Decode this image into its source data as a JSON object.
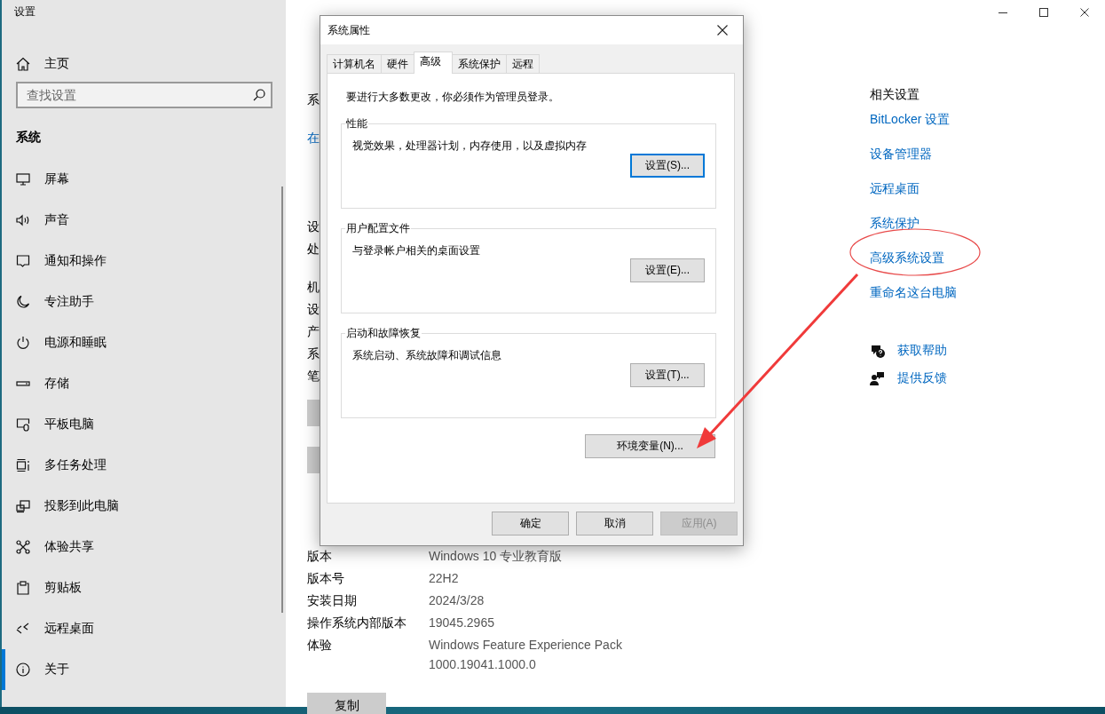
{
  "window": {
    "title": "设置"
  },
  "sidebar": {
    "home": "主页",
    "search": {
      "placeholder": "查找设置"
    },
    "section": "系统",
    "items": [
      {
        "label": "屏幕",
        "selected": false
      },
      {
        "label": "声音",
        "selected": false
      },
      {
        "label": "通知和操作",
        "selected": false
      },
      {
        "label": "专注助手",
        "selected": false
      },
      {
        "label": "电源和睡眠",
        "selected": false
      },
      {
        "label": "存储",
        "selected": false
      },
      {
        "label": "平板电脑",
        "selected": false
      },
      {
        "label": "多任务处理",
        "selected": false
      },
      {
        "label": "投影到此电脑",
        "selected": false
      },
      {
        "label": "体验共享",
        "selected": false
      },
      {
        "label": "剪贴板",
        "selected": false
      },
      {
        "label": "远程桌面",
        "selected": false
      },
      {
        "label": "关于",
        "selected": true
      }
    ]
  },
  "main": {
    "fragments": [
      {
        "kind": "text",
        "text": "系"
      },
      {
        "kind": "link",
        "text": "在"
      },
      {
        "kind": "text",
        "text": "设"
      },
      {
        "kind": "text",
        "text": "处"
      },
      {
        "kind": "text",
        "text": "机"
      },
      {
        "kind": "text",
        "text": "设"
      },
      {
        "kind": "text",
        "text": "产"
      },
      {
        "kind": "text",
        "text": "系"
      },
      {
        "kind": "text",
        "text": "笔"
      },
      {
        "kind": "button"
      },
      {
        "kind": "button"
      }
    ],
    "specs": [
      {
        "label": "版本",
        "value": "Windows 10 专业教育版"
      },
      {
        "label": "版本号",
        "value": "22H2"
      },
      {
        "label": "安装日期",
        "value": "2024/3/28"
      },
      {
        "label": "操作系统内部版本",
        "value": "19045.2965"
      },
      {
        "label": "体验",
        "value": "Windows Feature Experience Pack 1000.19041.1000.0"
      }
    ],
    "copy_button": "复制"
  },
  "related": {
    "heading": "相关设置",
    "links": [
      "BitLocker 设置",
      "设备管理器",
      "远程桌面",
      "系统保护",
      "高级系统设置",
      "重命名这台电脑"
    ],
    "help": [
      {
        "label": "获取帮助"
      },
      {
        "label": "提供反馈"
      }
    ]
  },
  "dialog": {
    "title": "系统属性",
    "tabs": [
      {
        "label": "计算机名",
        "selected": false
      },
      {
        "label": "硬件",
        "selected": false
      },
      {
        "label": "高级",
        "selected": true
      },
      {
        "label": "系统保护",
        "selected": false
      },
      {
        "label": "远程",
        "selected": false
      }
    ],
    "notice": "要进行大多数更改，你必须作为管理员登录。",
    "groups": [
      {
        "title": "性能",
        "description": "视觉效果，处理器计划，内存使用，以及虚拟内存",
        "button": "设置(S)...",
        "focused": true
      },
      {
        "title": "用户配置文件",
        "description": "与登录帐户相关的桌面设置",
        "button": "设置(E)...",
        "focused": false
      },
      {
        "title": "启动和故障恢复",
        "description": "系统启动、系统故障和调试信息",
        "button": "设置(T)...",
        "focused": false
      }
    ],
    "env_button": "环境变量(N)...",
    "buttons": [
      {
        "label": "确定",
        "disabled": false
      },
      {
        "label": "取消",
        "disabled": false
      },
      {
        "label": "应用(A)",
        "disabled": true
      }
    ]
  }
}
